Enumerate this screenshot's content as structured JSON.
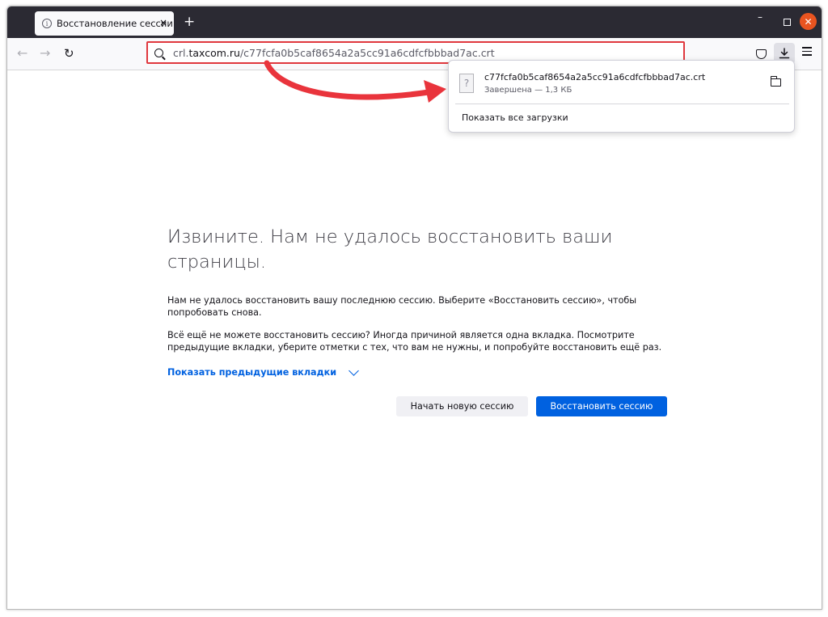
{
  "tab": {
    "title": "Восстановление сессии",
    "info_icon": "info-icon",
    "close_icon": "×"
  },
  "newtab_label": "+",
  "window_controls": {
    "minimize": "–",
    "close": "✕"
  },
  "urlbar": {
    "domain_prefix": "crl.",
    "domain": "taxcom.ru",
    "path": "/c77fcfa0b5caf8654a2a5cc91a6cdfcfbbbad7ac.crt"
  },
  "downloads": {
    "file_name": "c77fcfa0b5caf8654a2a5cc91a6cdfcfbbbad7ac.crt",
    "status": "Завершена — 1,3 КБ",
    "file_icon": "?",
    "show_all": "Показать все загрузки"
  },
  "main": {
    "title": "Извините. Нам не удалось восстановить ваши страницы.",
    "para1": "Нам не удалось восстановить вашу последнюю сессию. Выберите «Восстановить сессию», чтобы попробовать снова.",
    "para2": "Всё ещё не можете восстановить сессию? Иногда причиной является одна вкладка. Посмотрите предыдущие вкладки, уберите отметки с тех, что вам не нужны, и попробуйте восстановить ещё раз.",
    "show_prev": "Показать предыдущие вкладки",
    "new_session": "Начать новую сессию",
    "restore_session": "Восстановить сессию"
  },
  "colors": {
    "accent": "#0061e0",
    "highlight": "#e0383e",
    "tabbar": "#2b2a33"
  }
}
